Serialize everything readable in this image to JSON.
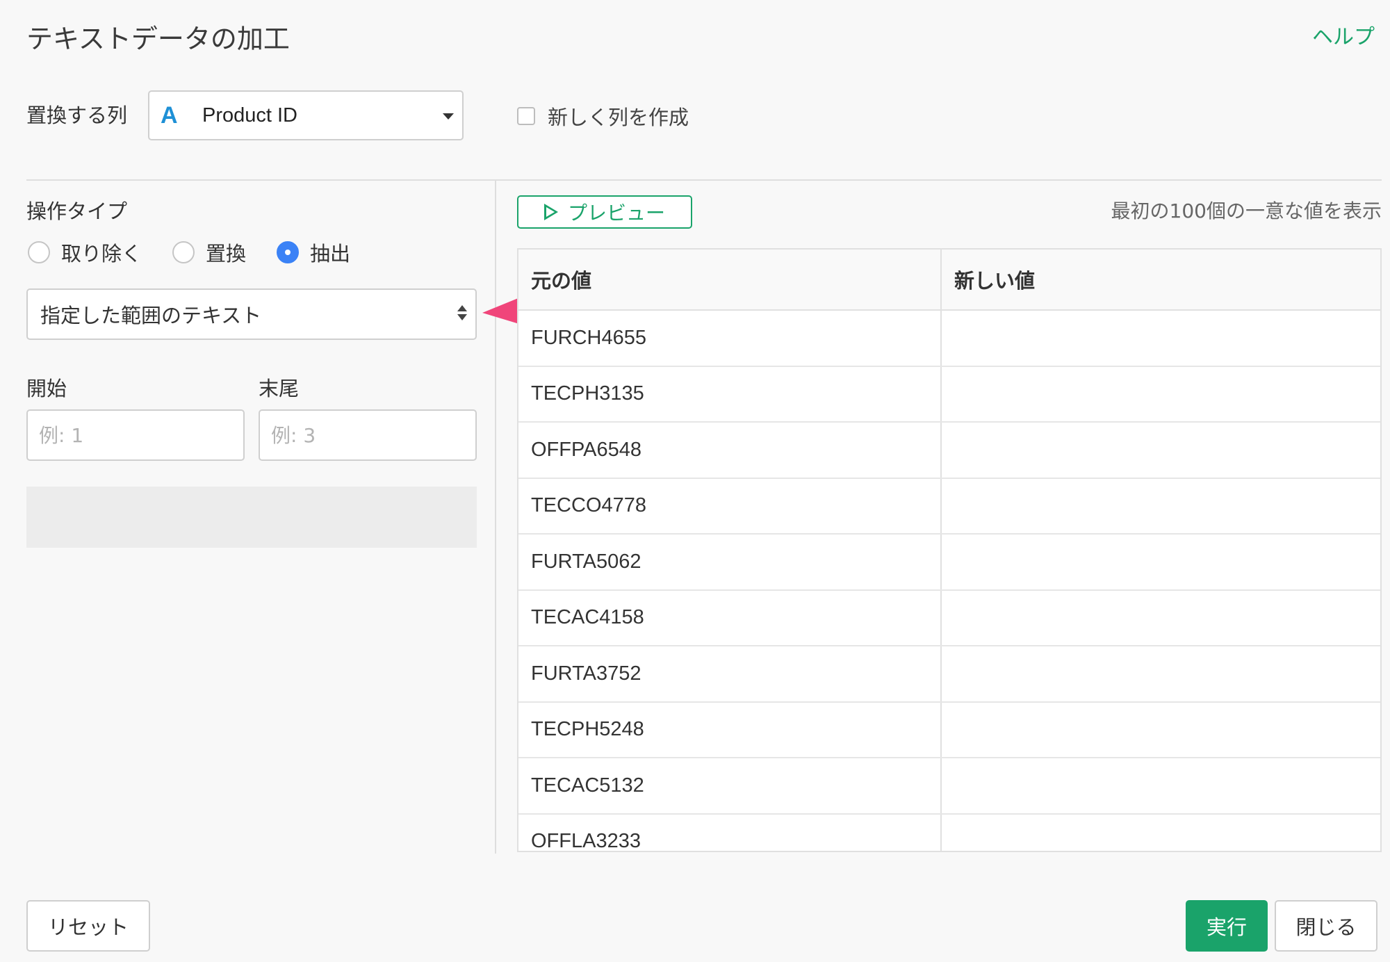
{
  "header": {
    "title": "テキストデータの加工",
    "help_label": "ヘルプ"
  },
  "column": {
    "label": "置換する列",
    "type_icon": "A",
    "selected": "Product ID",
    "new_column_label": "新しく列を作成",
    "new_column_checked": false
  },
  "operation": {
    "title": "操作タイプ",
    "options": [
      {
        "label": "取り除く",
        "selected": false
      },
      {
        "label": "置換",
        "selected": false
      },
      {
        "label": "抽出",
        "selected": true
      }
    ],
    "mode_selected": "指定した範囲のテキスト",
    "start_label": "開始",
    "start_placeholder": "例: 1",
    "end_label": "末尾",
    "end_placeholder": "例: 3"
  },
  "preview": {
    "button_label": "プレビュー",
    "note": "最初の100個の一意な値を表示",
    "columns": [
      "元の値",
      "新しい値"
    ],
    "rows": [
      [
        "FURCH4655",
        ""
      ],
      [
        "TECPH3135",
        ""
      ],
      [
        "OFFPA6548",
        ""
      ],
      [
        "TECCO4778",
        ""
      ],
      [
        "FURTA5062",
        ""
      ],
      [
        "TECAC4158",
        ""
      ],
      [
        "FURTA3752",
        ""
      ],
      [
        "TECPH5248",
        ""
      ],
      [
        "TECAC5132",
        ""
      ],
      [
        "OFFLA3233",
        ""
      ]
    ]
  },
  "footer": {
    "reset_label": "リセット",
    "run_label": "実行",
    "close_label": "閉じる"
  },
  "colors": {
    "accent_green": "#1aa36a",
    "radio_blue": "#3b82f6",
    "type_icon_blue": "#1e90d6",
    "annotation_pink": "#f0457a"
  },
  "icons": {
    "arrow_annotation": "arrow-left-icon",
    "preview": "play-icon"
  }
}
